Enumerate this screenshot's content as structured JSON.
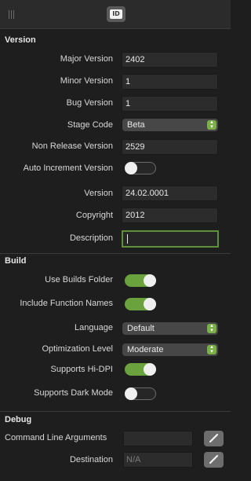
{
  "toolbar": {
    "id_icon_text": "ID"
  },
  "version": {
    "title": "Version",
    "major_label": "Major Version",
    "major_value": "2402",
    "minor_label": "Minor Version",
    "minor_value": "1",
    "bug_label": "Bug Version",
    "bug_value": "1",
    "stage_label": "Stage Code",
    "stage_value": "Beta",
    "nonrelease_label": "Non Release Version",
    "nonrelease_value": "2529",
    "autoinc_label": "Auto Increment Version",
    "autoinc_on": false,
    "version_label": "Version",
    "version_value": "24.02.0001",
    "copyright_label": "Copyright",
    "copyright_value": "2012",
    "description_label": "Description",
    "description_value": ""
  },
  "build": {
    "title": "Build",
    "use_builds_label": "Use Builds Folder",
    "use_builds_on": true,
    "include_fn_label": "Include Function Names",
    "include_fn_on": true,
    "language_label": "Language",
    "language_value": "Default",
    "optimization_label": "Optimization Level",
    "optimization_value": "Moderate",
    "hidpi_label": "Supports Hi-DPI",
    "hidpi_on": true,
    "darkmode_label": "Supports Dark Mode",
    "darkmode_on": false
  },
  "debug": {
    "title": "Debug",
    "cmdline_label": "Command Line Arguments",
    "cmdline_value": "",
    "destination_label": "Destination",
    "destination_placeholder": "N/A"
  },
  "colors": {
    "accent_green": "#6aa33d",
    "background": "#1e1e1e"
  }
}
